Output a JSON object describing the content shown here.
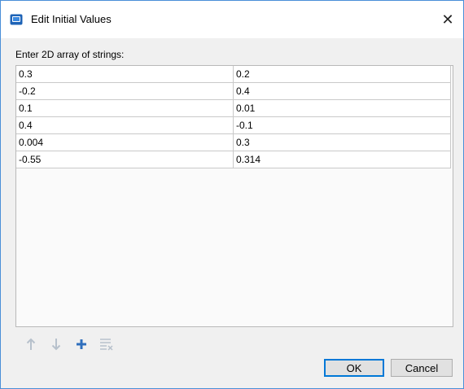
{
  "window": {
    "title": "Edit Initial Values",
    "app_icon": "app-dialog-icon",
    "close_icon": "close-icon",
    "close_glyph": "✕"
  },
  "prompt": "Enter 2D array of strings:",
  "grid": {
    "rows": [
      [
        "0.3",
        "0.2"
      ],
      [
        "-0.2",
        "0.4"
      ],
      [
        "0.1",
        "0.01"
      ],
      [
        "0.4",
        "-0.1"
      ],
      [
        "0.004",
        "0.3"
      ],
      [
        "-0.55",
        "0.314"
      ]
    ]
  },
  "toolbar": {
    "items": [
      {
        "name": "move-up-icon",
        "enabled": false
      },
      {
        "name": "move-down-icon",
        "enabled": false
      },
      {
        "name": "add-row-icon",
        "enabled": true
      },
      {
        "name": "clear-rows-icon",
        "enabled": false
      }
    ]
  },
  "buttons": {
    "ok_label": "OK",
    "cancel_label": "Cancel"
  },
  "colors": {
    "accent": "#0078d7",
    "disabled_icon": "#b7c1cc",
    "add_icon": "#2f6fbd"
  }
}
